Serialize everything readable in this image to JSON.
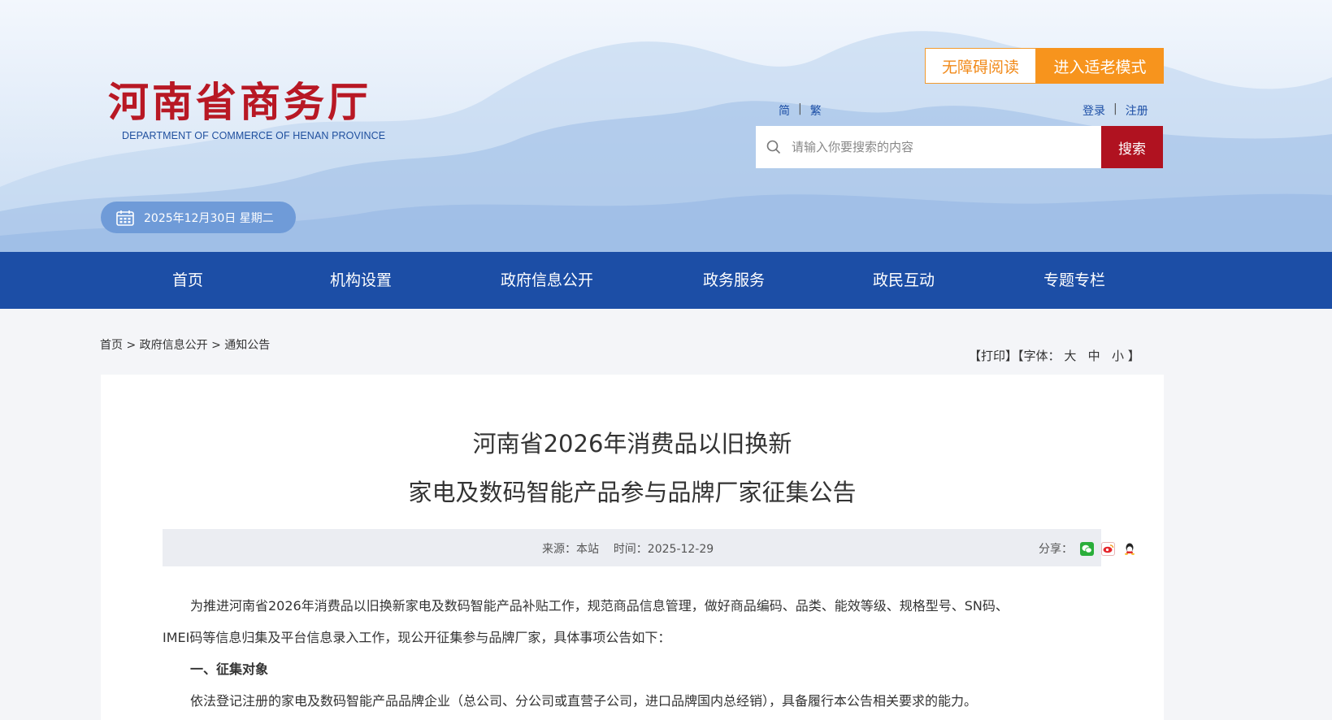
{
  "header": {
    "logo_cn": "河南省商务厅",
    "logo_en": "DEPARTMENT OF COMMERCE OF HENAN PROVINCE",
    "accessibility_label": "无障碍阅读",
    "elder_mode_label": "进入适老模式",
    "lang": {
      "simplified": "简",
      "traditional": "繁",
      "separator": "|"
    },
    "auth": {
      "login": "登录",
      "register": "注册",
      "separator": "|"
    },
    "search": {
      "placeholder": "请输入你要搜索的内容",
      "button": "搜索"
    },
    "date": "2025年12月30日 星期二"
  },
  "nav": {
    "items": [
      "首页",
      "机构设置",
      "政府信息公开",
      "政务服务",
      "政民互动",
      "专题专栏"
    ]
  },
  "breadcrumb": {
    "items": [
      "首页",
      "政府信息公开",
      "通知公告"
    ],
    "separator": ">"
  },
  "tools": {
    "print": "【打印】",
    "font_label": "【字体：",
    "large": "大",
    "medium": "中",
    "small": "小",
    "close": "】"
  },
  "article": {
    "title_line1": "河南省2026年消费品以旧换新",
    "title_line2": "家电及数码智能产品参与品牌厂家征集公告",
    "meta": {
      "source": "来源：本站",
      "time": "时间：2025-12-29",
      "share_label": "分享："
    },
    "para1_line1": "为推进河南省2026年消费品以旧换新家电及数码智能产品补贴工作，规范商品信息管理，做好商品编码、品类、能效等级、规格型号、SN码、",
    "para1_line2": "IMEI码等信息归集及平台信息录入工作，现公开征集参与品牌厂家，具体事项公告如下：",
    "section1_heading": "一、征集对象",
    "section1_text": "依法登记注册的家电及数码智能产品品牌企业（总公司、分公司或直营子公司，进口品牌国内总经销），具备履行本公告相关要求的能力。"
  },
  "colors": {
    "nav_bg": "#1c4ea6",
    "logo_red": "#b81824",
    "search_btn": "#b01220",
    "elder_btn": "#f7941d",
    "date_pill": "#6f9bd8"
  }
}
